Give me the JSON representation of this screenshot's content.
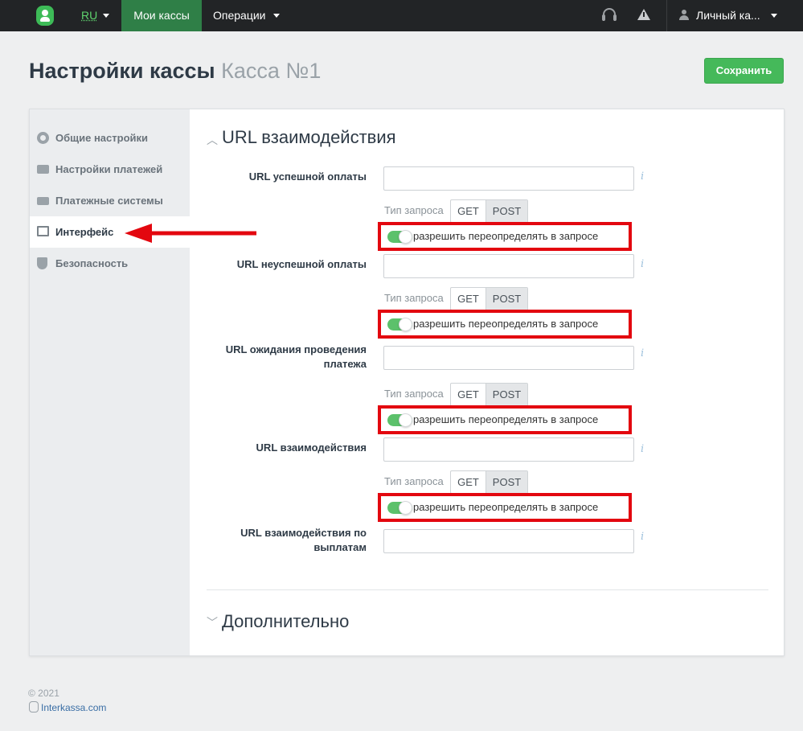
{
  "topbar": {
    "lang": "RU",
    "nav_my_cashes": "Мои кассы",
    "nav_operations": "Операции",
    "account": "Личный ка..."
  },
  "page": {
    "title": "Настройки кассы",
    "subtitle": "Касса №1",
    "save_label": "Сохранить"
  },
  "sidebar": {
    "items": [
      {
        "label": "Общие настройки",
        "icon": "gear-icon"
      },
      {
        "label": "Настройки платежей",
        "icon": "card-icon"
      },
      {
        "label": "Платежные системы",
        "icon": "money-icon"
      },
      {
        "label": "Интерфейс",
        "icon": "window-icon",
        "active": true
      },
      {
        "label": "Безопасность",
        "icon": "shield-icon"
      }
    ]
  },
  "section": {
    "title": "URL взаимодействия",
    "request_type_label": "Тип запроса",
    "get": "GET",
    "post": "POST",
    "override_label": "разрешить переопределять в запросе",
    "info": "i",
    "fields": [
      {
        "label": "URL успешной оплаты",
        "value": ""
      },
      {
        "label": "URL неуспешной оплаты",
        "value": ""
      },
      {
        "label": "URL ожидания проведения платежа",
        "value": ""
      },
      {
        "label": "URL взаимодействия",
        "value": ""
      },
      {
        "label": "URL взаимодействия по выплатам",
        "value": ""
      }
    ]
  },
  "section2": {
    "title": "Дополнительно"
  },
  "footer": {
    "copyright": "© 2021",
    "link": "Interkassa.com"
  },
  "colors": {
    "accent": "#45b95a",
    "nav_active": "#2f7f47",
    "highlight": "#e3070f"
  }
}
